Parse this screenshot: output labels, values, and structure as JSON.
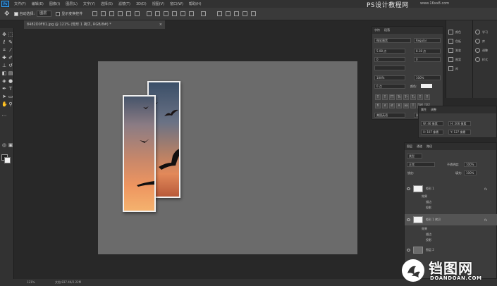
{
  "menu": {
    "logo": "Ps",
    "items": [
      "文件(F)",
      "编辑(E)",
      "图像(I)",
      "图层(L)",
      "文字(Y)",
      "选择(S)",
      "滤镜(T)",
      "3D(D)",
      "视图(V)",
      "窗口(W)",
      "帮助(H)"
    ],
    "brand": "PS设计教程网",
    "brand_url": "www.16xx8.com"
  },
  "options": {
    "auto_select_label": "自动选择:",
    "auto_select_value": "图层",
    "transform_label": "显示变换控件"
  },
  "document": {
    "tab_title": "8482D0F81.jpg @ 121% (矩形 1 拷贝, RGB/8#) *",
    "close": "×"
  },
  "status": {
    "zoom": "121%",
    "doc_info": "文档:837.4K/2.22M"
  },
  "char_panel": {
    "tabs": [
      "字符",
      "段落"
    ],
    "font_family": "微软雅黑",
    "font_style": "Regular",
    "size": "5.08 点",
    "leading": "8.18 点",
    "kerning": "0",
    "tracking": "0",
    "vscale": "100%",
    "hscale": "100%",
    "baseline": "0 点",
    "color_label": "颜色:",
    "lang": "美国英语",
    "aa": "锐利",
    "aa_value": "a"
  },
  "props_panel": {
    "tabs": [
      "属性",
      "调整"
    ],
    "w": "W: 46 像素",
    "h": "H: 206 像素",
    "x": "X: 107 像素",
    "y": "Y: 127 像素"
  },
  "right_icons": {
    "col1": [
      "颜色",
      "色板",
      "渐变",
      "图案",
      "库"
    ],
    "col2": [
      "学习",
      "库",
      "调整",
      "样式"
    ]
  },
  "layers_panel": {
    "tabs": [
      "图层",
      "通道",
      "路径"
    ],
    "kind": "类型",
    "blend": "正常",
    "opacity_label": "不透明度:",
    "opacity": "100%",
    "lock_label": "锁定:",
    "fill_label": "填充:",
    "fill": "100%",
    "layers": [
      {
        "name": "矩形 1",
        "fx": "fx",
        "effects": [
          "效果",
          "描边",
          "投影"
        ]
      },
      {
        "name": "矩形 1 拷贝",
        "fx": "fx",
        "effects": [
          "效果",
          "描边",
          "投影"
        ]
      },
      {
        "name": "图层 2"
      }
    ]
  },
  "watermark": {
    "text": "铛图网",
    "url": "DOANDOAN.COM"
  }
}
